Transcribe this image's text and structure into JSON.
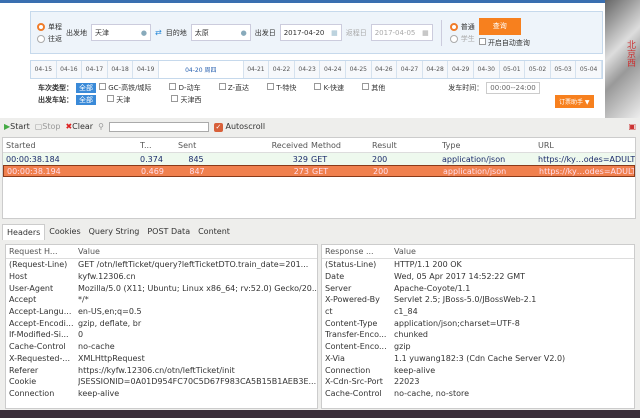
{
  "web": {
    "trip": [
      "单程",
      "往返"
    ],
    "from_label": "出发地",
    "from": "天津",
    "to_label": "目的地",
    "to": "太原",
    "depart_label": "出发日",
    "depart": "2017-04-20",
    "return_label": "返程日",
    "return": "2017-04-05",
    "passenger": [
      "普通",
      "学生"
    ],
    "query": "查询",
    "auto_query": "开启自动查询",
    "dates": [
      "04-15",
      "04-16",
      "04-17",
      "04-18",
      "04-19",
      "04-20 周四",
      "04-21",
      "04-22",
      "04-23",
      "04-24",
      "04-25",
      "04-26",
      "04-27",
      "04-28",
      "04-29",
      "04-30",
      "05-01",
      "05-02",
      "05-03",
      "05-04"
    ],
    "train_type_label": "车次类型：",
    "all": "全部",
    "train_types": [
      "GC-高铁/城际",
      "D-动车",
      "Z-直达",
      "T-特快",
      "K-快速",
      "其他"
    ],
    "station_label": "出发车站：",
    "stations": [
      "天津",
      "天津西"
    ],
    "time_label": "发车时间：",
    "time_value": "00:00--24:00",
    "order_btn": "订票助手 ▼",
    "side_text": "北京西"
  },
  "toolbar": {
    "start": "Start",
    "stop": "Stop",
    "clear": "Clear",
    "autoscroll": "Autoscroll"
  },
  "list": {
    "headers": [
      "Started",
      "T...",
      "Sent",
      "Received",
      "Method",
      "Result",
      "Type",
      "URL"
    ],
    "rows": [
      [
        "00:00:38.184",
        "0.374",
        "845",
        "329",
        "GET",
        "200",
        "application/json",
        "https://ky…odes=ADULT"
      ],
      [
        "00:00:38.194",
        "0.469",
        "847",
        "273",
        "GET",
        "200",
        "application/json",
        "https://ky…odes=ADULT"
      ]
    ]
  },
  "tabs": [
    "Headers",
    "Cookies",
    "Query String",
    "POST Data",
    "Content"
  ],
  "request": {
    "headers": [
      "Request H...",
      "Value"
    ],
    "rows": [
      [
        "(Request-Line)",
        "GET /otn/leftTicket/query?leftTicketDTO.train_date=201..."
      ],
      [
        "Host",
        "kyfw.12306.cn"
      ],
      [
        "User-Agent",
        "Mozilla/5.0 (X11; Ubuntu; Linux x86_64; rv:52.0) Gecko/20..."
      ],
      [
        "Accept",
        "*/*"
      ],
      [
        "Accept-Langu...",
        "en-US,en;q=0.5"
      ],
      [
        "Accept-Encodi...",
        "gzip, deflate, br"
      ],
      [
        "If-Modified-Si...",
        "0"
      ],
      [
        "Cache-Control",
        "no-cache"
      ],
      [
        "X-Requested-...",
        "XMLHttpRequest"
      ],
      [
        "Referer",
        "https://kyfw.12306.cn/otn/leftTicket/init"
      ],
      [
        "Cookie",
        "JSESSIONID=0A01D954FC70C5D67F983CA5B15B1AEB3E..."
      ],
      [
        "Connection",
        "keep-alive"
      ]
    ]
  },
  "response": {
    "headers": [
      "Response ...",
      "Value"
    ],
    "rows": [
      [
        "(Status-Line)",
        "HTTP/1.1 200 OK"
      ],
      [
        "Date",
        "Wed, 05 Apr 2017 14:52:22 GMT"
      ],
      [
        "Server",
        "Apache-Coyote/1.1"
      ],
      [
        "X-Powered-By",
        "Servlet 2.5; JBoss-5.0/JBossWeb-2.1"
      ],
      [
        "ct",
        "c1_84"
      ],
      [
        "Content-Type",
        "application/json;charset=UTF-8"
      ],
      [
        "Transfer-Enco...",
        "chunked"
      ],
      [
        "Content-Enco...",
        "gzip"
      ],
      [
        "X-Via",
        "1.1 yuwang182:3 (Cdn Cache Server V2.0)"
      ],
      [
        "Connection",
        "keep-alive"
      ],
      [
        "X-Cdn-Src-Port",
        "22023"
      ],
      [
        "Cache-Control",
        "no-cache, no-store"
      ]
    ]
  }
}
